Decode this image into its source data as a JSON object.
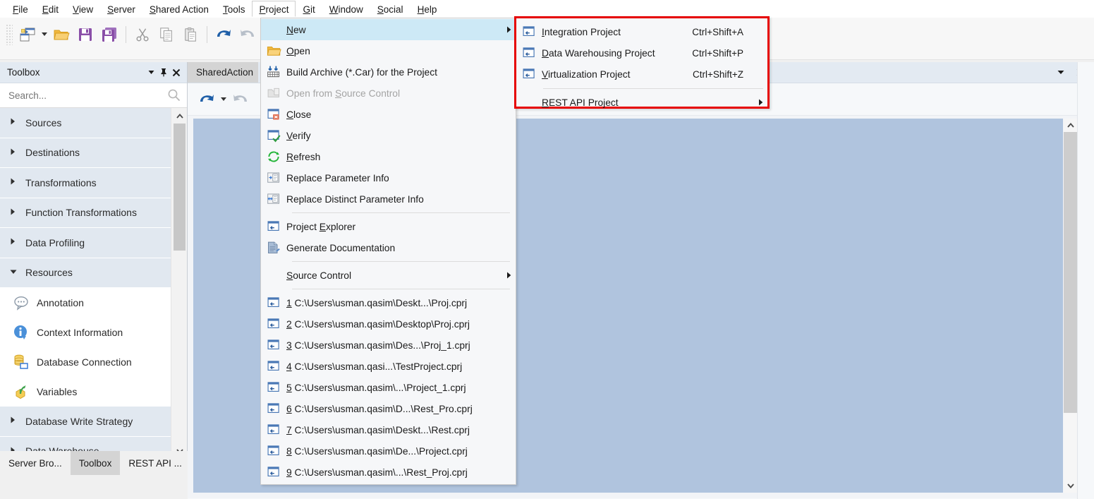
{
  "app": {
    "menubar": [
      {
        "name": "file",
        "label": "File",
        "mnemonic": "F",
        "active": false
      },
      {
        "name": "edit",
        "label": "Edit",
        "mnemonic": "E",
        "active": false
      },
      {
        "name": "view",
        "label": "View",
        "mnemonic": "V",
        "active": false
      },
      {
        "name": "server",
        "label": "Server",
        "mnemonic": "S",
        "active": false
      },
      {
        "name": "shared-action",
        "label": "Shared Action",
        "mnemonic": "S",
        "active": false
      },
      {
        "name": "tools",
        "label": "Tools",
        "mnemonic": "T",
        "active": false
      },
      {
        "name": "project",
        "label": "Project",
        "mnemonic": "P",
        "active": true
      },
      {
        "name": "git",
        "label": "Git",
        "mnemonic": "G",
        "active": false
      },
      {
        "name": "window",
        "label": "Window",
        "mnemonic": "W",
        "active": false
      },
      {
        "name": "social",
        "label": "Social",
        "mnemonic": "S",
        "active": false
      },
      {
        "name": "help",
        "label": "Help",
        "mnemonic": "H",
        "active": false
      }
    ],
    "toolbar": [
      {
        "name": "new-project-button",
        "icon": "new-project-icon",
        "has_dropdown": true
      },
      {
        "name": "open-button",
        "icon": "open-folder-icon",
        "has_dropdown": false
      },
      {
        "name": "save-button",
        "icon": "save-icon",
        "has_dropdown": false
      },
      {
        "name": "save-all-button",
        "icon": "save-all-icon",
        "has_dropdown": false
      },
      {
        "name": "cut-button",
        "icon": "scissors-icon",
        "has_dropdown": false
      },
      {
        "name": "copy-button",
        "icon": "copy-icon",
        "has_dropdown": false
      },
      {
        "name": "paste-button",
        "icon": "paste-icon",
        "has_dropdown": false
      },
      {
        "name": "undo-button",
        "icon": "undo-arrow-icon",
        "has_dropdown": false
      },
      {
        "name": "redo-button",
        "icon": "redo-arrow-icon",
        "has_dropdown": false
      }
    ]
  },
  "toolbox": {
    "title": "Toolbox",
    "search": {
      "placeholder": "Search...",
      "value": ""
    },
    "header_buttons": [
      {
        "name": "panel-menu-button",
        "icon": "chevron-down-icon"
      },
      {
        "name": "panel-pin-button",
        "icon": "pin-icon"
      },
      {
        "name": "panel-close-button",
        "icon": "close-icon"
      }
    ],
    "items": [
      {
        "kind": "category",
        "label": "Sources",
        "expanded": false
      },
      {
        "kind": "category",
        "label": "Destinations",
        "expanded": false
      },
      {
        "kind": "category",
        "label": "Transformations",
        "expanded": false
      },
      {
        "kind": "category",
        "label": "Function Transformations",
        "expanded": false
      },
      {
        "kind": "category",
        "label": "Data Profiling",
        "expanded": false
      },
      {
        "kind": "category",
        "label": "Resources",
        "expanded": true
      },
      {
        "kind": "item",
        "label": "Annotation",
        "icon": "annotation-icon"
      },
      {
        "kind": "item",
        "label": "Context Information",
        "icon": "info-icon"
      },
      {
        "kind": "item",
        "label": "Database Connection",
        "icon": "database-connection-icon"
      },
      {
        "kind": "item",
        "label": "Variables",
        "icon": "variables-icon"
      },
      {
        "kind": "category",
        "label": "Database Write Strategy",
        "expanded": false
      },
      {
        "kind": "category",
        "label": "Data Warehouse",
        "expanded": false
      }
    ]
  },
  "dock_tabs": [
    {
      "label": "Server Bro...",
      "active": false,
      "name": "dock-tab-server-browser"
    },
    {
      "label": "Toolbox",
      "active": true,
      "name": "dock-tab-toolbox"
    },
    {
      "label": "REST API ...",
      "active": false,
      "name": "dock-tab-rest-api"
    }
  ],
  "document": {
    "tab_label": "SharedAction",
    "tab_controls": [
      {
        "name": "document-list-button",
        "icon": "chevron-down-icon"
      },
      {
        "name": "document-close-button",
        "icon": "close-icon"
      }
    ],
    "toolbar": [
      {
        "name": "doc-undo-button",
        "icon": "undo-arrow-icon",
        "has_dropdown": true
      },
      {
        "name": "doc-redo-button",
        "icon": "redo-arrow-icon",
        "has_dropdown": false
      }
    ]
  },
  "project_menu": {
    "items": [
      {
        "type": "item",
        "label": "New",
        "mnemonic": "N",
        "icon": null,
        "shortcut": "",
        "submenu": true,
        "highlight": true,
        "disabled": false
      },
      {
        "type": "item",
        "label": "Open",
        "mnemonic": "O",
        "icon": "open-folder-icon",
        "shortcut": "",
        "submenu": false,
        "highlight": false,
        "disabled": false
      },
      {
        "type": "item",
        "label": "Build Archive (*.Car) for the Project",
        "mnemonic": "",
        "icon": "build-archive-icon",
        "shortcut": "",
        "submenu": false,
        "highlight": false,
        "disabled": false
      },
      {
        "type": "item",
        "label": "Open from Source Control",
        "mnemonic": "S",
        "icon": "source-control-open-icon",
        "shortcut": "",
        "submenu": false,
        "highlight": false,
        "disabled": true
      },
      {
        "type": "item",
        "label": "Close",
        "mnemonic": "C",
        "icon": "close-project-icon",
        "shortcut": "",
        "submenu": false,
        "highlight": false,
        "disabled": false
      },
      {
        "type": "item",
        "label": "Verify",
        "mnemonic": "V",
        "icon": "verify-icon",
        "shortcut": "",
        "submenu": false,
        "highlight": false,
        "disabled": false
      },
      {
        "type": "item",
        "label": "Refresh",
        "mnemonic": "R",
        "icon": "refresh-icon",
        "shortcut": "",
        "submenu": false,
        "highlight": false,
        "disabled": false
      },
      {
        "type": "item",
        "label": "Replace Parameter Info",
        "mnemonic": "",
        "icon": "replace-parameter-icon",
        "shortcut": "",
        "submenu": false,
        "highlight": false,
        "disabled": false
      },
      {
        "type": "item",
        "label": "Replace Distinct Parameter Info",
        "mnemonic": "",
        "icon": "replace-distinct-parameter-icon",
        "shortcut": "",
        "submenu": false,
        "highlight": false,
        "disabled": false
      },
      {
        "type": "separator"
      },
      {
        "type": "item",
        "label": "Project Explorer",
        "mnemonic": "E",
        "icon": "project-icon",
        "shortcut": "",
        "submenu": false,
        "highlight": false,
        "disabled": false
      },
      {
        "type": "item",
        "label": "Generate Documentation",
        "mnemonic": "",
        "icon": "documentation-icon",
        "shortcut": "",
        "submenu": false,
        "highlight": false,
        "disabled": false
      },
      {
        "type": "separator"
      },
      {
        "type": "item",
        "label": "Source Control",
        "mnemonic": "S",
        "icon": null,
        "shortcut": "",
        "submenu": true,
        "highlight": false,
        "disabled": false
      },
      {
        "type": "separator"
      },
      {
        "type": "mru",
        "index": "1",
        "label": "C:\\Users\\usman.qasim\\Deskt...\\Proj.cprj",
        "icon": "project-icon"
      },
      {
        "type": "mru",
        "index": "2",
        "label": "C:\\Users\\usman.qasim\\Desktop\\Proj.cprj",
        "icon": "project-icon"
      },
      {
        "type": "mru",
        "index": "3",
        "label": "C:\\Users\\usman.qasim\\Des...\\Proj_1.cprj",
        "icon": "project-icon"
      },
      {
        "type": "mru",
        "index": "4",
        "label": "C:\\Users\\usman.qasi...\\TestProject.cprj",
        "icon": "project-icon"
      },
      {
        "type": "mru",
        "index": "5",
        "label": "C:\\Users\\usman.qasim\\...\\Project_1.cprj",
        "icon": "project-icon"
      },
      {
        "type": "mru",
        "index": "6",
        "label": "C:\\Users\\usman.qasim\\D...\\Rest_Pro.cprj",
        "icon": "project-icon"
      },
      {
        "type": "mru",
        "index": "7",
        "label": "C:\\Users\\usman.qasim\\Deskt...\\Rest.cprj",
        "icon": "project-icon"
      },
      {
        "type": "mru",
        "index": "8",
        "label": "C:\\Users\\usman.qasim\\De...\\Project.cprj",
        "icon": "project-icon"
      },
      {
        "type": "mru",
        "index": "9",
        "label": "C:\\Users\\usman.qasim\\...\\Rest_Proj.cprj",
        "icon": "project-icon"
      }
    ]
  },
  "new_submenu": {
    "highlight_color": "#e60000",
    "items": [
      {
        "type": "item",
        "label": "Integration Project",
        "mnemonic": "I",
        "icon": "project-icon",
        "shortcut": "Ctrl+Shift+A",
        "submenu": false
      },
      {
        "type": "item",
        "label": "Data Warehousing Project",
        "mnemonic": "D",
        "icon": "project-icon",
        "shortcut": "Ctrl+Shift+P",
        "submenu": false
      },
      {
        "type": "item",
        "label": "Virtualization Project",
        "mnemonic": "V",
        "icon": "project-icon",
        "shortcut": "Ctrl+Shift+Z",
        "submenu": false
      },
      {
        "type": "separator"
      },
      {
        "type": "item",
        "label": "REST API Project",
        "mnemonic": "R",
        "icon": null,
        "shortcut": "",
        "submenu": true
      }
    ]
  }
}
